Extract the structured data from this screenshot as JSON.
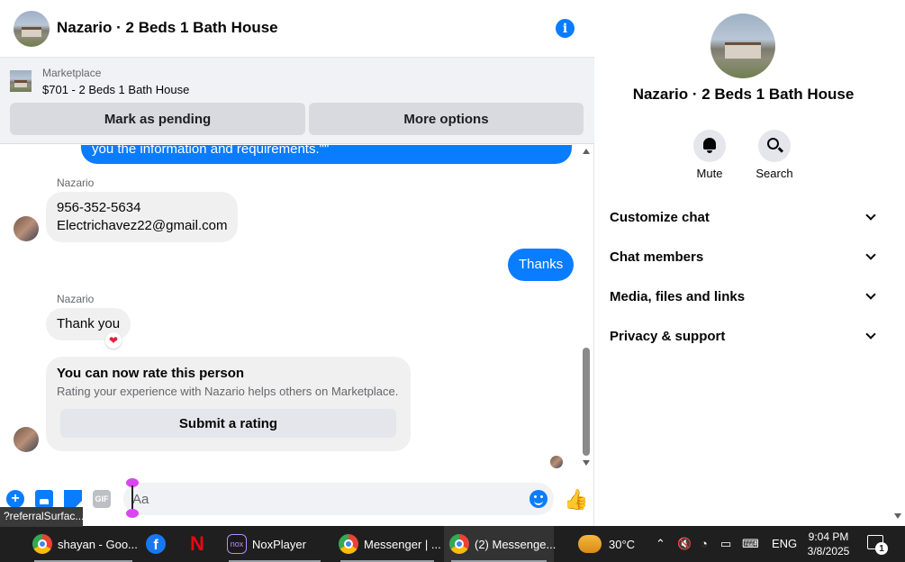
{
  "header": {
    "title": "Nazario · 2 Beds 1 Bath House",
    "info_glyph": "i"
  },
  "marketplace": {
    "label": "Marketplace",
    "listing": "$701 - 2 Beds 1 Bath House",
    "pending_label": "Mark as pending",
    "more_label": "More options"
  },
  "messages": {
    "top_partial": "you the information and requirements.\"\"",
    "sender1": "Nazario",
    "phone": "956-352-5634",
    "email": "Electrichavez22@gmail.com",
    "outgoing": "Thanks",
    "sender2": "Nazario",
    "thank_you": "Thank you",
    "reaction": "❤"
  },
  "rating": {
    "title": "You can now rate this person",
    "subtitle": "Rating your experience with Nazario helps others on Marketplace.",
    "button": "Submit a rating"
  },
  "composer": {
    "placeholder": "Aa",
    "plus_glyph": "+",
    "gif_label": "GIF",
    "like_glyph": "👍",
    "tooltip": "?referralSurfac..."
  },
  "side": {
    "title": "Nazario · 2 Beds 1 Bath House",
    "mute_label": "Mute",
    "search_label": "Search",
    "rows": [
      "Customize chat",
      "Chat members",
      "Media, files and links",
      "Privacy & support"
    ]
  },
  "taskbar": {
    "items": [
      "shayan - Goo...",
      "NoxPlayer",
      "Messenger | ...",
      "(2) Messenge..."
    ],
    "nox_glyph": "nox",
    "fb_glyph": "f",
    "netflix_glyph": "N",
    "temperature": "30°C",
    "language": "ENG",
    "time": "9:04 PM",
    "date": "3/8/2025",
    "notification_count": "1"
  },
  "colors": {
    "messenger_blue": "#0a7cff",
    "taskbar": "#1f1f1f"
  }
}
